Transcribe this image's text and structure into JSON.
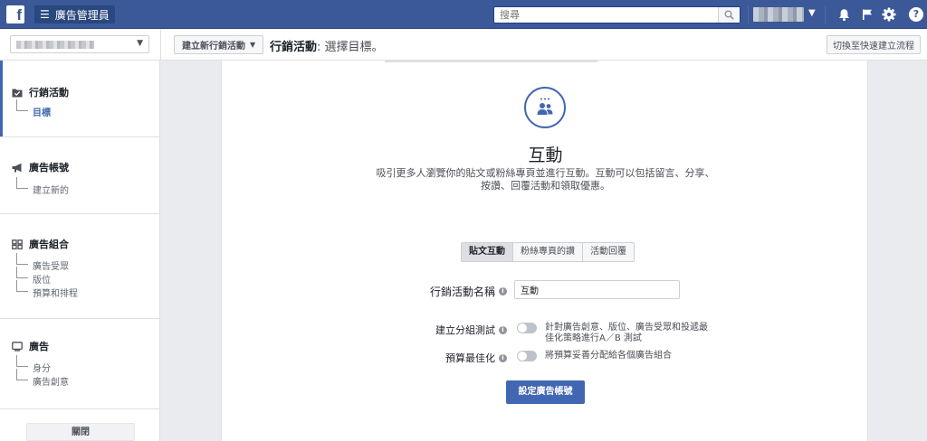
{
  "topbar": {
    "logo": "f",
    "app_title": "廣告管理員",
    "search_placeholder": "搜尋",
    "icons": [
      "facebook-logo",
      "menu-icon",
      "search-icon",
      "bell-icon",
      "flag-icon",
      "gear-icon",
      "help-icon"
    ],
    "help_label": "?"
  },
  "subbar": {
    "create_button": "建立新行銷活動",
    "heading_main": "行銷活動",
    "heading_sub": ": 選擇目標。",
    "switch_button": "切換至快速建立流程"
  },
  "sidebar": {
    "sections": [
      {
        "label": "行銷活動",
        "icon": "campaign-icon",
        "items": [
          "目標"
        ]
      },
      {
        "label": "廣告帳號",
        "icon": "megaphone-icon",
        "items": [
          "建立新的"
        ]
      },
      {
        "label": "廣告組合",
        "icon": "adset-grid-icon",
        "items": [
          "廣告受眾",
          "版位",
          "預算和排程"
        ]
      },
      {
        "label": "廣告",
        "icon": "ad-monitor-icon",
        "items": [
          "身分",
          "廣告創意"
        ]
      }
    ],
    "close_button": "關閉"
  },
  "main": {
    "objective_icon": "engagement-people-icon",
    "objective_title": "互動",
    "objective_description": "吸引更多人瀏覽你的貼文或粉絲專頁並進行互動。互動可以包括留言、分享、按讚、回覆活動和領取優惠。",
    "tabs": [
      "貼文互動",
      "粉絲專頁的讚",
      "活動回覆"
    ],
    "active_tab": "貼文互動",
    "campaign_name_label": "行銷活動名稱",
    "campaign_name_value": "互動",
    "split_test_label": "建立分組測試",
    "split_test_desc": "針對廣告創意、版位、廣告受眾和投遞最佳化策略進行A／B 測試",
    "split_test_on": false,
    "budget_opt_label": "預算最佳化",
    "budget_opt_desc": "將預算妥善分配給各個廣告組合",
    "budget_opt_on": false,
    "primary_button": "設定廣告帳號"
  },
  "colors": {
    "facebook_blue": "#3b5998",
    "accent": "#4267b2"
  }
}
